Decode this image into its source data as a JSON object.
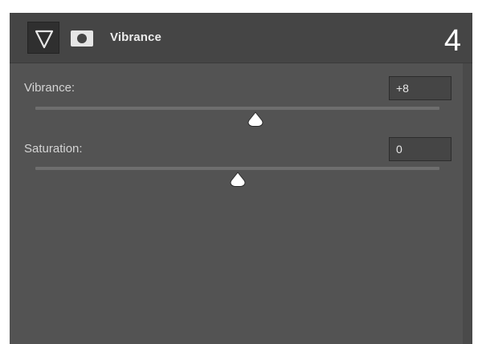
{
  "header": {
    "title": "Vibrance",
    "step_number": "4",
    "adjustment_icon": "adjustment-triangle-icon",
    "mask_icon": "layer-mask-icon"
  },
  "controls": [
    {
      "label": "Vibrance:",
      "value": "+8",
      "slider_fraction": 0.544
    },
    {
      "label": "Saturation:",
      "value": "0",
      "slider_fraction": 0.5
    }
  ],
  "colors": {
    "panel_bg": "#535353",
    "header_bg": "#454545",
    "track": "#6e6e6e",
    "thumb": "#ffffff"
  }
}
